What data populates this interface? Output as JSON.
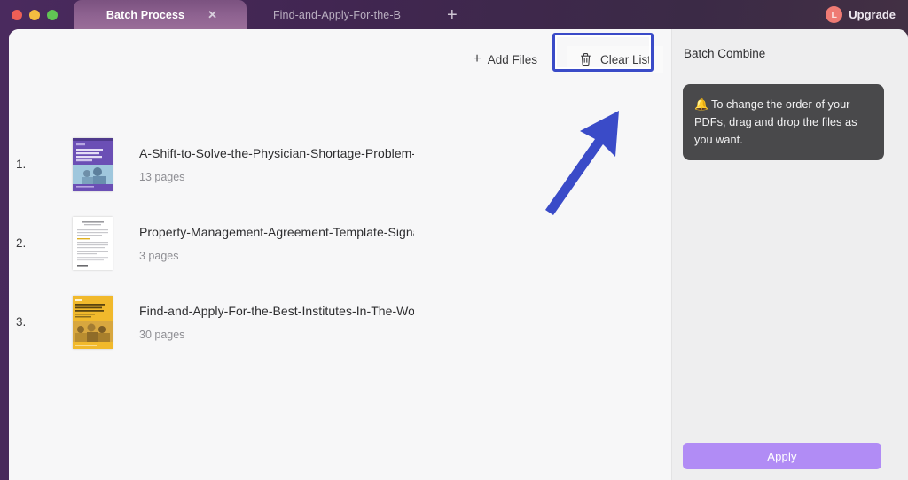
{
  "window": {
    "traffic_lights": [
      "close",
      "minimize",
      "maximize"
    ]
  },
  "titlebar": {
    "tabs": [
      {
        "label": "Batch Process",
        "active": true,
        "close_icon": "✕"
      },
      {
        "label": "Find-and-Apply-For-the-B",
        "active": false
      }
    ],
    "new_tab_icon": "+",
    "upgrade": {
      "badge_letter": "L",
      "label": "Upgrade",
      "badge_color": "#ef7b74"
    }
  },
  "toolbar": {
    "add_files_label": "Add Files",
    "add_files_icon": "+",
    "clear_list_label": "Clear List",
    "clear_list_icon": "trash-icon",
    "highlight_color": "#3a4bc8"
  },
  "annotation": {
    "arrow_color": "#3a4bc8",
    "points_to": "Clear List"
  },
  "files": [
    {
      "index": "1.",
      "name": "A-Shift-to-Solve-the-Physician-Shortage-Problem-ar",
      "pages": "13 pages",
      "thumb_color": "#6b4fb5"
    },
    {
      "index": "2.",
      "name": "Property-Management-Agreement-Template-Signatur",
      "pages": "3 pages",
      "thumb_color": "#ffffff"
    },
    {
      "index": "3.",
      "name": "Find-and-Apply-For-the-Best-Institutes-In-The-World",
      "pages": "30 pages",
      "thumb_color": "#f1b92c"
    }
  ],
  "sidepanel": {
    "title": "Batch Combine",
    "tip_icon": "🔔",
    "tip_text": "To change the order of your PDFs, drag and drop the files as you want.",
    "apply_label": "Apply",
    "apply_color": "#b18cf5"
  }
}
